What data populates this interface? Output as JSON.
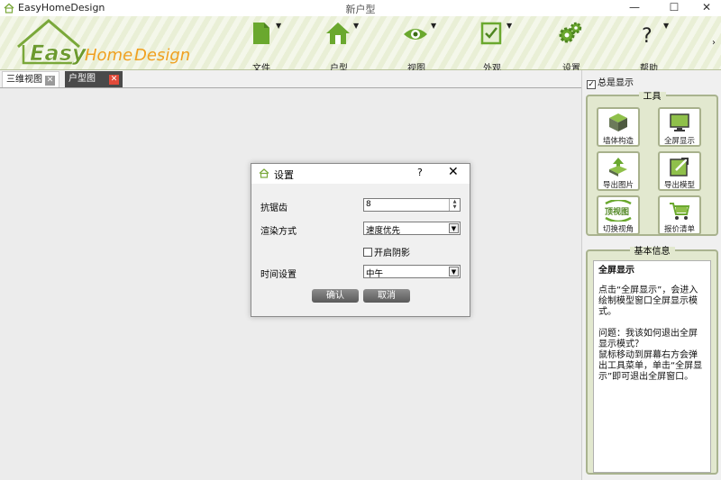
{
  "app": {
    "name": "EasyHomeDesign",
    "document_title": "新户型"
  },
  "window_controls": {
    "minimize": "—",
    "maximize": "☐",
    "close": "✕"
  },
  "logo": {
    "easy": "Easy",
    "home": "Home",
    "design": "Design"
  },
  "ribbon": {
    "tools": [
      {
        "label": "文件",
        "icon": "document-icon"
      },
      {
        "label": "户型",
        "icon": "house-icon"
      },
      {
        "label": "视图",
        "icon": "eye-icon"
      },
      {
        "label": "外观",
        "icon": "appearance-icon"
      },
      {
        "label": "设置",
        "icon": "gears-icon"
      },
      {
        "label": "帮助",
        "icon": "help-icon"
      }
    ],
    "more": "›"
  },
  "tabs": [
    {
      "label": "三维视图",
      "close": "✕"
    },
    {
      "label": "户型图",
      "close": "✕"
    }
  ],
  "right_panel": {
    "always_show": {
      "label": "总是显示",
      "checked": true
    },
    "tools_group": {
      "title": "工具",
      "buttons": [
        {
          "label": "墙体构造",
          "icon": "wall-cube-icon"
        },
        {
          "label": "全屏显示",
          "icon": "monitor-icon"
        },
        {
          "label": "导出图片",
          "icon": "export-image-icon"
        },
        {
          "label": "导出模型",
          "icon": "export-model-icon"
        },
        {
          "label": "切换视角",
          "icon": "switch-view-icon",
          "badge": "顶视图"
        },
        {
          "label": "报价清单",
          "icon": "cart-icon"
        }
      ]
    },
    "info_group": {
      "title": "基本信息",
      "heading": "全屏显示",
      "paragraphs": [
        "点击“全屏显示”，会进入绘制模型窗口全屏显示模式。",
        "问题：我该如何退出全屏显示模式？\n 鼠标移动到屏幕右方会弹出工具菜单，单击“全屏显示”即可退出全屏窗口。"
      ]
    }
  },
  "dialog": {
    "title": "设置",
    "help": "?",
    "close": "✕",
    "antialias": {
      "label": "抗锯齿",
      "value": "8"
    },
    "render_mode": {
      "label": "渲染方式",
      "value": "速度优先"
    },
    "shadow": {
      "label": "开启阴影",
      "checked": false
    },
    "time": {
      "label": "时间设置",
      "value": "中午"
    },
    "ok": "确认",
    "cancel": "取消"
  },
  "colors": {
    "accent_green": "#7aa83a",
    "logo_orange": "#f0a020",
    "tab_close_red": "#e24a3a"
  }
}
